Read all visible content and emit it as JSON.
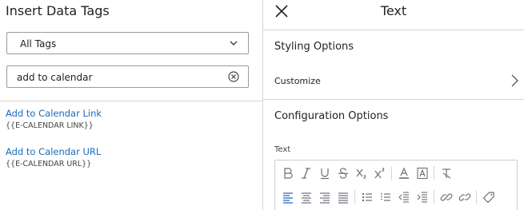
{
  "left_panel": {
    "title": "Insert Data Tags",
    "filter": {
      "selected": "All Tags"
    },
    "search": {
      "value": "add to calendar",
      "placeholder": ""
    },
    "results": [
      {
        "label": "Add to Calendar Link",
        "code": "{{E-CALENDAR LINK}}"
      },
      {
        "label": "Add to Calendar URL",
        "code": "{{E-CALENDAR URL}}"
      }
    ]
  },
  "right_panel": {
    "title": "Text",
    "styling_section": "Styling Options",
    "customize_label": "Customize",
    "configuration_section": "Configuration Options",
    "field_label": "Text",
    "toolbar_row1": [
      "bold-icon",
      "italic-icon",
      "underline-icon",
      "strikethrough-icon",
      "subscript-icon",
      "superscript-icon",
      "font-color-icon",
      "background-color-icon",
      "clear-formatting-icon"
    ],
    "toolbar_row2": [
      "align-left-icon",
      "align-center-icon",
      "align-right-icon",
      "align-justify-icon",
      "bulleted-list-icon",
      "numbered-list-icon",
      "outdent-icon",
      "indent-icon",
      "link-icon",
      "unlink-icon",
      "tag-icon"
    ]
  },
  "colors": {
    "link": "#1a6bbd",
    "icon": "#6b6f7a",
    "active_icon": "#2b6cc4",
    "divider": "#d6d6d6"
  }
}
